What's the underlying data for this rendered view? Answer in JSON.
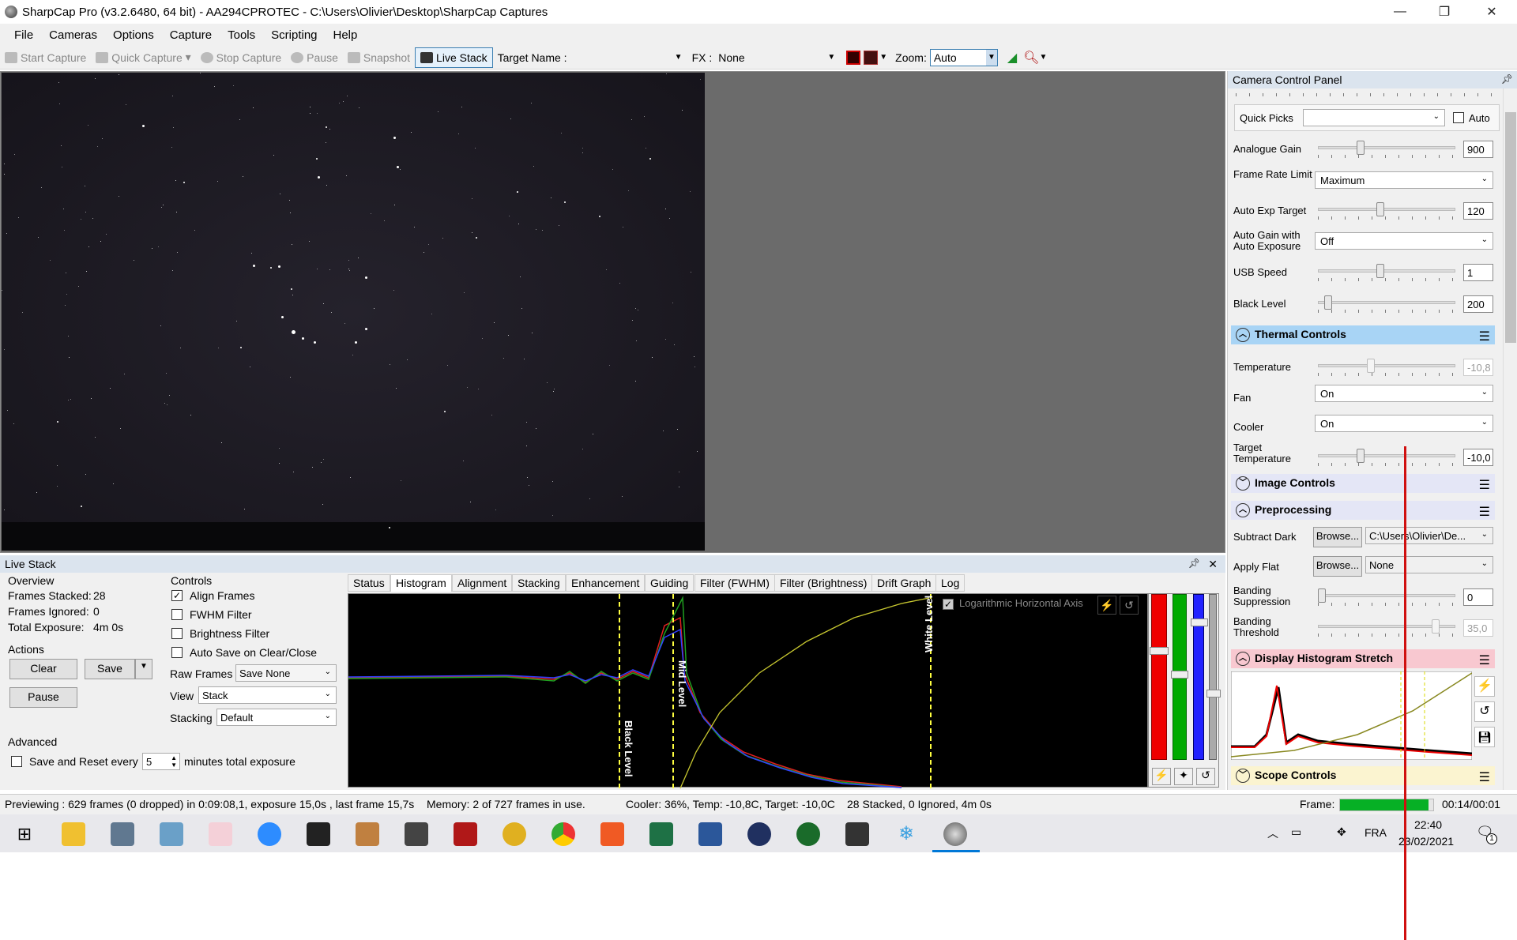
{
  "window": {
    "title": "SharpCap Pro (v3.2.6480, 64 bit) - AA294CPROTEC - C:\\Users\\Olivier\\Desktop\\SharpCap Captures",
    "minimize": "—",
    "restore": "❐",
    "close": "✕"
  },
  "menu": [
    "File",
    "Cameras",
    "Options",
    "Capture",
    "Tools",
    "Scripting",
    "Help"
  ],
  "toolbar": {
    "start_capture": "Start Capture",
    "quick_capture": "Quick Capture",
    "stop_capture": "Stop Capture",
    "pause": "Pause",
    "snapshot": "Snapshot",
    "live_stack": "Live Stack",
    "target_name_label": "Target Name :",
    "target_name_value": "",
    "fx_label": "FX :",
    "fx_value": "None",
    "zoom_label": "Zoom:",
    "zoom_value": "Auto"
  },
  "ccp": {
    "title": "Camera Control Panel",
    "quick_picks_label": "Quick Picks",
    "auto_label": "Auto",
    "controls": [
      {
        "label": "Analogue Gain",
        "value": "900",
        "pos": 0.3
      },
      {
        "label": "Auto Exp Target",
        "value": "120",
        "pos": 0.45
      },
      {
        "label": "USB Speed",
        "value": "1",
        "pos": 0.45
      },
      {
        "label": "Black Level",
        "value": "200",
        "pos": 0.05
      }
    ],
    "frame_rate_label": "Frame Rate Limit",
    "frame_rate_value": "Maximum",
    "auto_gain_label": "Auto Gain with Auto Exposure",
    "auto_gain_value": "Off",
    "thermal_title": "Thermal Controls",
    "temperature_label": "Temperature",
    "temperature_value": "-10,8",
    "temperature_pos": 0.38,
    "fan_label": "Fan",
    "fan_value": "On",
    "cooler_label": "Cooler",
    "cooler_value": "On",
    "target_temp_label": "Target Temperature",
    "target_temp_value": "-10,0",
    "target_temp_pos": 0.3,
    "image_controls_title": "Image Controls",
    "preprocessing_title": "Preprocessing",
    "subtract_dark_label": "Subtract Dark",
    "browse_label": "Browse...",
    "subtract_dark_value": "C:\\Users\\Olivier\\De...",
    "apply_flat_label": "Apply Flat",
    "apply_flat_value": "None",
    "banding_supp_label": "Banding Suppression",
    "banding_supp_value": "0",
    "banding_supp_pos": 0.0,
    "banding_thr_label": "Banding Threshold",
    "banding_thr_value": "35,0",
    "banding_thr_pos": 0.88,
    "display_hist_title": "Display Histogram Stretch",
    "scope_title": "Scope Controls",
    "colors": {
      "thermal": "#a8d4f5",
      "image": "#e4e6f6",
      "display": "#f8c8d0",
      "scope": "#fbf4d0"
    }
  },
  "livestack": {
    "title": "Live Stack",
    "overview_label": "Overview",
    "frames_stacked_label": "Frames Stacked:",
    "frames_stacked": "28",
    "frames_ignored_label": "Frames Ignored:",
    "frames_ignored": "0",
    "total_exposure_label": "Total Exposure:",
    "total_exposure": "4m 0s",
    "actions_label": "Actions",
    "clear": "Clear",
    "save": "Save",
    "pause": "Pause",
    "advanced_label": "Advanced",
    "save_reset_label": "Save and Reset every",
    "save_reset_value": "5",
    "minutes_label": "minutes total exposure",
    "controls_label": "Controls",
    "align_frames": "Align Frames",
    "fwhm_filter": "FWHM Filter",
    "brightness_filter": "Brightness Filter",
    "auto_save": "Auto Save on Clear/Close",
    "raw_frames_label": "Raw Frames",
    "raw_frames_value": "Save None",
    "view_label": "View",
    "view_value": "Stack",
    "stacking_label": "Stacking",
    "stacking_value": "Default",
    "tabs": [
      "Status",
      "Histogram",
      "Alignment",
      "Stacking",
      "Enhancement",
      "Guiding",
      "Filter (FWHM)",
      "Filter (Brightness)",
      "Drift Graph",
      "Log"
    ],
    "log_axis": "Logarithmic Horizontal Axis",
    "black_level": "Black Level",
    "mid_level": "Mid Level",
    "white_level": "White Level"
  },
  "status": {
    "previewing": "Previewing : 629 frames (0 dropped) in 0:09:08,1, exposure 15,0s , last frame 15,7s",
    "memory": "Memory: 2 of 727 frames in use.",
    "cooler": "Cooler: 36%, Temp: -10,8C, Target: -10,0C",
    "stacked": "28 Stacked, 0 Ignored, 4m 0s",
    "frame_label": "Frame:",
    "frame_time": "00:14/00:01",
    "frame_progress": 0.95
  },
  "taskbar": {
    "lang": "FRA",
    "time": "22:40",
    "date": "23/02/2021",
    "notif": "1"
  }
}
